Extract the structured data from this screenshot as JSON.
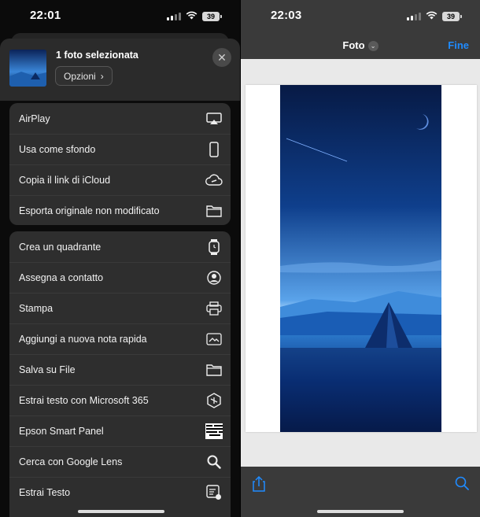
{
  "left": {
    "status": {
      "time": "22:01",
      "battery": "39"
    },
    "sheet": {
      "title": "1 foto selezionata",
      "options_label": "Opzioni"
    },
    "group1": [
      {
        "label": "AirPlay",
        "icon": "airplay-icon"
      },
      {
        "label": "Usa come sfondo",
        "icon": "phone-icon"
      },
      {
        "label": "Copia il link di iCloud",
        "icon": "cloud-link-icon"
      },
      {
        "label": "Esporta originale non modificato",
        "icon": "folder-icon"
      }
    ],
    "group2": [
      {
        "label": "Crea un quadrante",
        "icon": "watch-icon"
      },
      {
        "label": "Assegna a contatto",
        "icon": "contact-icon"
      },
      {
        "label": "Stampa",
        "icon": "printer-icon"
      },
      {
        "label": "Aggiungi a nuova nota rapida",
        "icon": "quick-note-icon"
      },
      {
        "label": "Salva su File",
        "icon": "folder-icon"
      },
      {
        "label": "Estrai testo con Microsoft 365",
        "icon": "microsoft-365-icon"
      },
      {
        "label": "Epson Smart Panel",
        "icon": "epson-icon"
      },
      {
        "label": "Cerca con Google Lens",
        "icon": "search-icon"
      },
      {
        "label": "Estrai Testo",
        "icon": "extract-text-icon"
      }
    ]
  },
  "right": {
    "status": {
      "time": "22:03",
      "battery": "39"
    },
    "nav": {
      "title": "Foto",
      "done": "Fine"
    }
  },
  "colors": {
    "accent": "#1f8bff",
    "sheet_bg": "#2e2e2e",
    "bar_bg": "#3a3a3a"
  }
}
